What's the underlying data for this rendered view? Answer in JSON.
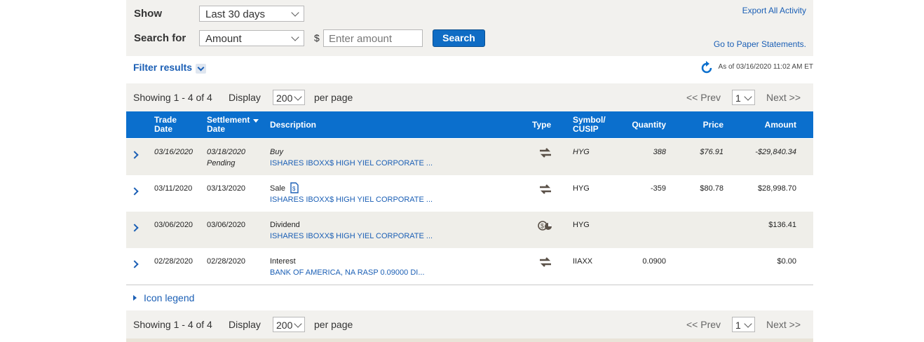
{
  "filters": {
    "show_label": "Show",
    "show_value": "Last 30 days",
    "search_label": "Search for",
    "search_value": "Amount",
    "currency_symbol": "$",
    "amount_placeholder": "Enter amount",
    "search_button": "Search",
    "export_link": "Export All Activity",
    "paper_link": "Go to Paper Statements.",
    "filter_results": "Filter results",
    "as_of": "As of 03/16/2020 11:02 AM ET"
  },
  "pagination": {
    "showing": "Showing 1 - 4 of 4",
    "display_label": "Display",
    "page_size": "200",
    "per_page": "per page",
    "prev": "<< Prev",
    "page": "1",
    "next": "Next >>"
  },
  "table": {
    "headers": {
      "trade": "Trade Date",
      "settlement": "Settlement Date",
      "description": "Description",
      "type": "Type",
      "symbol": "Symbol/ CUSIP",
      "quantity": "Quantity",
      "price": "Price",
      "amount": "Amount"
    },
    "rows": [
      {
        "trade": "03/16/2020",
        "settlement": "03/18/2020",
        "status": "Pending",
        "action": "Buy",
        "desc": "ISHARES IBOXX$ HIGH YIEL CORPORATE ...",
        "type_icon": "transfer-arrows-icon",
        "symbol": "HYG",
        "quantity": "388",
        "price": "$76.91",
        "amount": "-$29,840.34"
      },
      {
        "trade": "03/11/2020",
        "settlement": "03/13/2020",
        "status": "",
        "action": "Sale",
        "desc": "ISHARES IBOXX$ HIGH YIEL CORPORATE ...",
        "type_icon": "transfer-arrows-icon",
        "symbol": "HYG",
        "quantity": "-359",
        "price": "$80.78",
        "amount": "$28,998.70"
      },
      {
        "trade": "03/06/2020",
        "settlement": "03/06/2020",
        "status": "",
        "action": "Dividend",
        "desc": "ISHARES IBOXX$ HIGH YIEL CORPORATE ...",
        "type_icon": "dividend-coin-icon",
        "symbol": "HYG",
        "quantity": "",
        "price": "",
        "amount": "$136.41"
      },
      {
        "trade": "02/28/2020",
        "settlement": "02/28/2020",
        "status": "",
        "action": "Interest",
        "desc": "BANK OF AMERICA, NA RASP 0.09000 DI...",
        "type_icon": "transfer-arrows-icon",
        "symbol": "IIAXX",
        "quantity": "0.0900",
        "price": "",
        "amount": "$0.00"
      }
    ]
  },
  "icon_legend": "Icon legend",
  "colors": {
    "header_blue": "#0b6fcd",
    "link_blue": "#1b5fb5",
    "panel_beige": "#f2f1ee",
    "row_alt": "#efeee9"
  }
}
